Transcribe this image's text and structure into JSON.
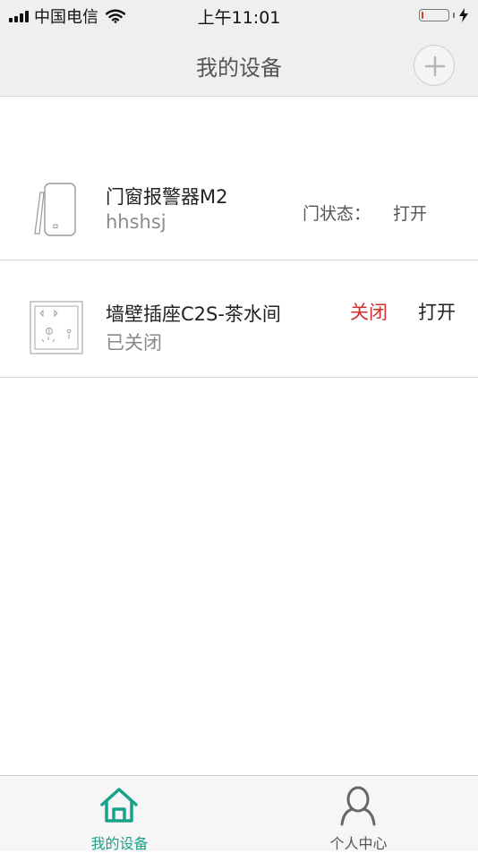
{
  "status_bar": {
    "carrier": "中国电信",
    "time": "上午11:01",
    "battery_level": 0.08,
    "icons": [
      "signal-icon",
      "wifi-icon",
      "battery-icon",
      "charging-bolt-icon"
    ]
  },
  "nav": {
    "title": "我的设备",
    "add_icon": "plus-icon"
  },
  "devices": [
    {
      "name": "门窗报警器M2",
      "subtitle": "hhshsj",
      "status_label": "门状态：",
      "status_value": "打开",
      "icon": "door-window-sensor-icon"
    },
    {
      "name": "墙壁插座C2S-茶水间",
      "subtitle": "已关闭",
      "off_label": "关闭",
      "on_label": "打开",
      "icon": "wall-socket-icon"
    }
  ],
  "tabs": [
    {
      "label": "我的设备",
      "icon": "home-icon",
      "active": true
    },
    {
      "label": "个人中心",
      "icon": "person-icon",
      "active": false
    }
  ],
  "colors": {
    "accent": "#1aa18a",
    "danger": "#d32f2f",
    "header_bg": "#efefef",
    "tab_inactive": "#555555"
  }
}
